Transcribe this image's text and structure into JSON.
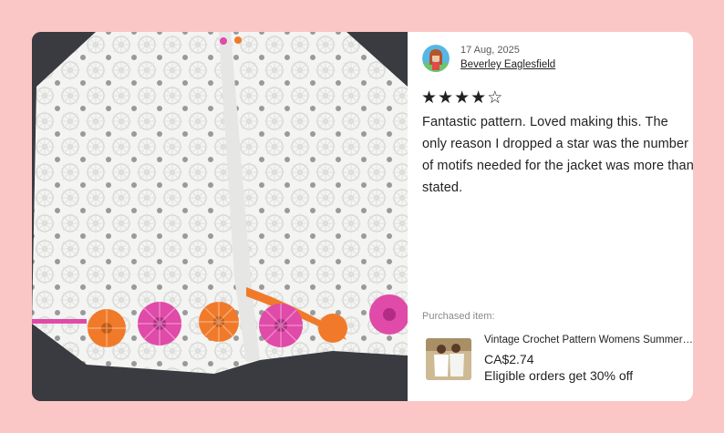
{
  "review": {
    "date": "17 Aug, 2025",
    "reviewer_name": "Beverley Eaglesfield",
    "rating": 4,
    "rating_max": 5,
    "text": "Fantastic pattern. Loved making this. The only reason I dropped a star was the number of motifs needed for the jacket was more than stated."
  },
  "purchased": {
    "label": "Purchased item:",
    "title": "Vintage Crochet Pattern Womens Summer Jacket",
    "price": "CA$2.74",
    "promo": "Eligible orders get 30% off"
  },
  "colors": {
    "page_background": "#fbc6c6",
    "card_background": "#ffffff",
    "photo_background": "#3a3b40",
    "motif_orange": "#f07a2a",
    "motif_pink": "#e04aa8"
  },
  "icons": {
    "star_full": "★",
    "star_empty": "☆"
  }
}
